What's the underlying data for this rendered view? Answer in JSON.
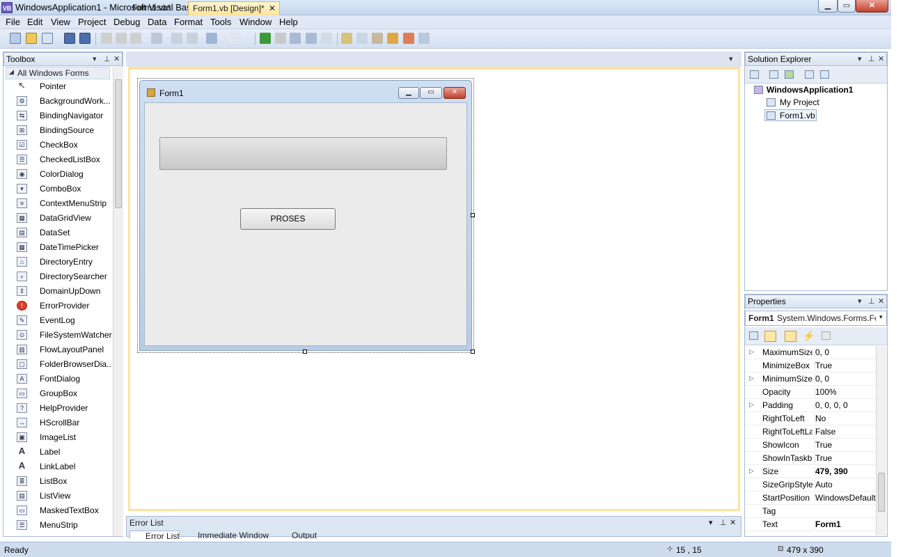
{
  "window": {
    "title": "WindowsApplication1 - Microsoft Visual Basic 2010 Express",
    "app_icon": "VB",
    "controls": [
      "minimize-icon",
      "maximize-icon",
      "close-icon"
    ]
  },
  "menu": [
    "File",
    "Edit",
    "View",
    "Project",
    "Debug",
    "Data",
    "Format",
    "Tools",
    "Window",
    "Help"
  ],
  "toolbox": {
    "title": "Toolbox",
    "group": "All Windows Forms",
    "items": [
      "Pointer",
      "BackgroundWork...",
      "BindingNavigator",
      "BindingSource",
      "CheckBox",
      "CheckedListBox",
      "ColorDialog",
      "ComboBox",
      "ContextMenuStrip",
      "DataGridView",
      "DataSet",
      "DateTimePicker",
      "DirectoryEntry",
      "DirectorySearcher",
      "DomainUpDown",
      "ErrorProvider",
      "EventLog",
      "FileSystemWatcher",
      "FlowLayoutPanel",
      "FolderBrowserDia...",
      "FontDialog",
      "GroupBox",
      "HelpProvider",
      "HScrollBar",
      "ImageList",
      "Label",
      "LinkLabel",
      "ListBox",
      "ListView",
      "MaskedTextBox",
      "MenuStrip"
    ]
  },
  "tabs": {
    "code": "Form1.vb*",
    "design": "Form1.vb [Design]*",
    "close": "✕"
  },
  "form": {
    "title": "Form1",
    "button_label": "PROSES"
  },
  "solution": {
    "title": "Solution Explorer",
    "project": "WindowsApplication1",
    "items": [
      "My Project",
      "Form1.vb"
    ]
  },
  "properties": {
    "title": "Properties",
    "object": "Form1",
    "object_type": "System.Windows.Forms.Fo",
    "rows": [
      {
        "name": "MaximumSize",
        "value": "0, 0",
        "expand": true
      },
      {
        "name": "MinimizeBox",
        "value": "True",
        "expand": false
      },
      {
        "name": "MinimumSize",
        "value": "0, 0",
        "expand": true
      },
      {
        "name": "Opacity",
        "value": "100%",
        "expand": false
      },
      {
        "name": "Padding",
        "value": "0, 0, 0, 0",
        "expand": true
      },
      {
        "name": "RightToLeft",
        "value": "No",
        "expand": false
      },
      {
        "name": "RightToLeftLayout",
        "value": "False",
        "expand": false
      },
      {
        "name": "ShowIcon",
        "value": "True",
        "expand": false
      },
      {
        "name": "ShowInTaskbar",
        "value": "True",
        "expand": false
      },
      {
        "name": "Size",
        "value": "479, 390",
        "expand": true,
        "bold": true
      },
      {
        "name": "SizeGripStyle",
        "value": "Auto",
        "expand": false
      },
      {
        "name": "StartPosition",
        "value": "WindowsDefaultLocation",
        "expand": false
      },
      {
        "name": "Tag",
        "value": "",
        "expand": false
      },
      {
        "name": "Text",
        "value": "Form1",
        "expand": false,
        "bold": true
      }
    ]
  },
  "bottom": {
    "title": "Error List",
    "tabs": [
      "Error List",
      "Immediate Window",
      "Output"
    ]
  },
  "status": {
    "ready": "Ready",
    "position": "15 , 15",
    "size": "479 x 390"
  }
}
